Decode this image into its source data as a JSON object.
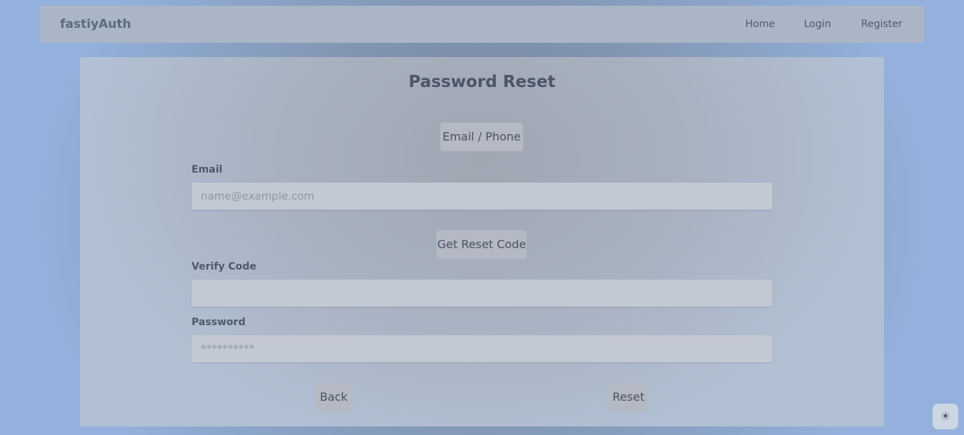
{
  "nav": {
    "brand": "fastiyAuth",
    "links": [
      "Home",
      "Login",
      "Register"
    ]
  },
  "form": {
    "title": "Password Reset",
    "method_button": "Email / Phone",
    "email_label": "Email",
    "email_placeholder": "name@example.com",
    "get_code_button": "Get Reset Code",
    "verify_label": "Verify Code",
    "verify_placeholder": "",
    "password_label": "Password",
    "password_placeholder": "**********",
    "back_button": "Back",
    "reset_button": "Reset"
  },
  "theme_toggle": {
    "icon": "sun-icon",
    "glyph": "☀"
  }
}
